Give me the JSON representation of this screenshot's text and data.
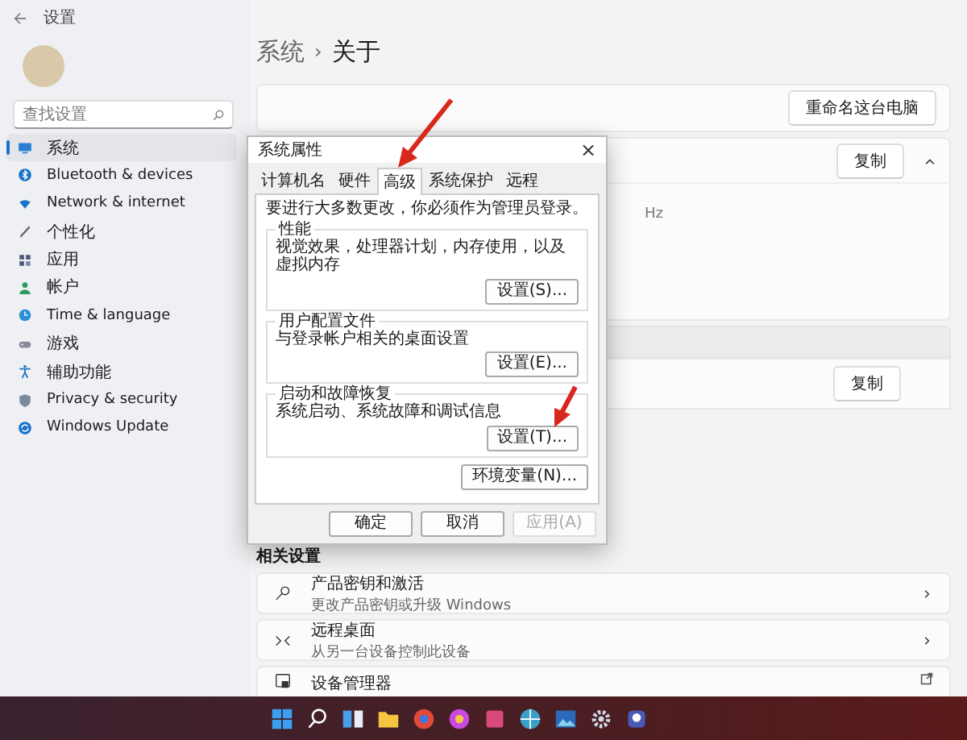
{
  "window": {
    "title": "设置"
  },
  "sidebar": {
    "search": {
      "placeholder": "查找设置"
    },
    "items": [
      {
        "label": "系统",
        "selected": true
      },
      {
        "label": "Bluetooth & devices",
        "selected": false
      },
      {
        "label": "Network & internet",
        "selected": false
      },
      {
        "label": "个性化",
        "selected": false
      },
      {
        "label": "应用",
        "selected": false
      },
      {
        "label": "帐户",
        "selected": false
      },
      {
        "label": "Time & language",
        "selected": false
      },
      {
        "label": "游戏",
        "selected": false
      },
      {
        "label": "辅助功能",
        "selected": false
      },
      {
        "label": "Privacy & security",
        "selected": false
      },
      {
        "label": "Windows Update",
        "selected": false
      }
    ]
  },
  "breadcrumb": {
    "parent": "系统",
    "separator": "›",
    "current": "关于"
  },
  "rename_button": "重命名这台电脑",
  "device_spec": {
    "copy_button": "复制",
    "expanded": true,
    "visible_text": "Hz"
  },
  "windows_spec": {
    "copy_button": "复制"
  },
  "related": {
    "heading": "相关设置",
    "items": [
      {
        "title": "产品密钥和激活",
        "subtitle": "更改产品密钥或升级 Windows",
        "kind": "chevron"
      },
      {
        "title": "远程桌面",
        "subtitle": "从另一台设备控制此设备",
        "kind": "chevron"
      },
      {
        "title": "设备管理器",
        "kind": "external"
      }
    ]
  },
  "dialog": {
    "title": "系统属性",
    "close": "×",
    "tabs": [
      {
        "label": "计算机名",
        "selected": false
      },
      {
        "label": "硬件",
        "selected": false
      },
      {
        "label": "高级",
        "selected": true
      },
      {
        "label": "系统保护",
        "selected": false
      },
      {
        "label": "远程",
        "selected": false
      }
    ],
    "notice": "要进行大多数更改，你必须作为管理员登录。",
    "groups": [
      {
        "legend": "性能",
        "text": "视觉效果，处理器计划，内存使用，以及虚拟内存",
        "button": "设置(S)..."
      },
      {
        "legend": "用户配置文件",
        "text": "与登录帐户相关的桌面设置",
        "button": "设置(E)..."
      },
      {
        "legend": "启动和故障恢复",
        "text": "系统启动、系统故障和调试信息",
        "button": "设置(T)..."
      }
    ],
    "env_button": "环境变量(N)...",
    "footer": [
      {
        "label": "确定",
        "disabled": false
      },
      {
        "label": "取消",
        "disabled": false
      },
      {
        "label": "应用(A)",
        "disabled": true
      }
    ]
  }
}
